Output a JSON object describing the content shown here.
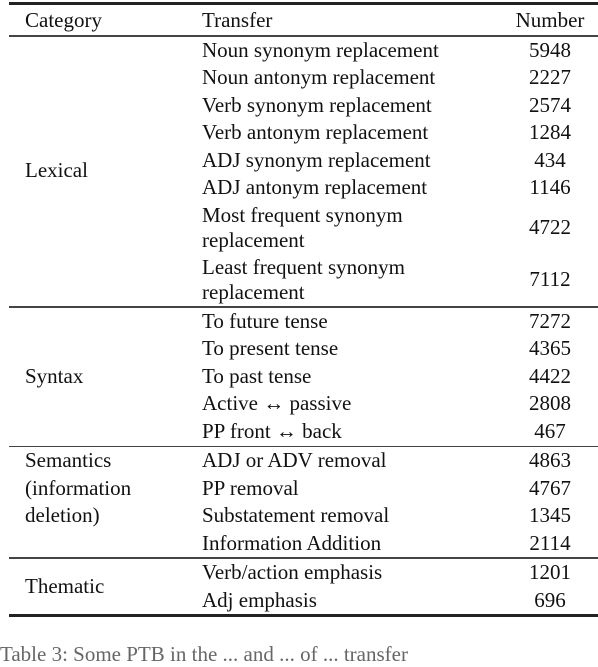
{
  "table": {
    "headers": {
      "category": "Category",
      "transfer": "Transfer",
      "number": "Number"
    },
    "groups": [
      {
        "category": "Lexical",
        "rows": [
          {
            "transfer": "Noun synonym replacement",
            "number": "5948"
          },
          {
            "transfer": "Noun antonym replacement",
            "number": "2227"
          },
          {
            "transfer": "Verb synonym replacement",
            "number": "2574"
          },
          {
            "transfer": "Verb antonym replacement",
            "number": "1284"
          },
          {
            "transfer": "ADJ synonym replacement",
            "number": "434"
          },
          {
            "transfer": "ADJ antonym replacement",
            "number": "1146"
          },
          {
            "transfer_line1": "Most frequent synonym",
            "transfer_line2": "replacement",
            "number": "4722"
          },
          {
            "transfer_line1": "Least frequent synonym",
            "transfer_line2": "replacement",
            "number": "7112"
          }
        ]
      },
      {
        "category": "Syntax",
        "rows": [
          {
            "transfer": "To future tense",
            "number": "7272"
          },
          {
            "transfer": "To present tense",
            "number": "4365"
          },
          {
            "transfer": "To past tense",
            "number": "4422"
          },
          {
            "transfer": "Active ↔ passive",
            "number": "2808"
          },
          {
            "transfer": "PP front ↔ back",
            "number": "467"
          }
        ]
      },
      {
        "category_lines": [
          "Semantics",
          "(information",
          "deletion)"
        ],
        "rows": [
          {
            "transfer": "ADJ or ADV removal",
            "number": "4863"
          },
          {
            "transfer": "PP removal",
            "number": "4767"
          },
          {
            "transfer": "Substatement removal",
            "number": "1345"
          },
          {
            "transfer": "Information Addition",
            "number": "2114"
          }
        ]
      },
      {
        "category": "Thematic",
        "rows": [
          {
            "transfer": "Verb/action emphasis",
            "number": "1201"
          },
          {
            "transfer": "Adj emphasis",
            "number": "696"
          }
        ]
      }
    ]
  },
  "caption": "Table 3: Some PTB in the ... and ... of ... transfer"
}
